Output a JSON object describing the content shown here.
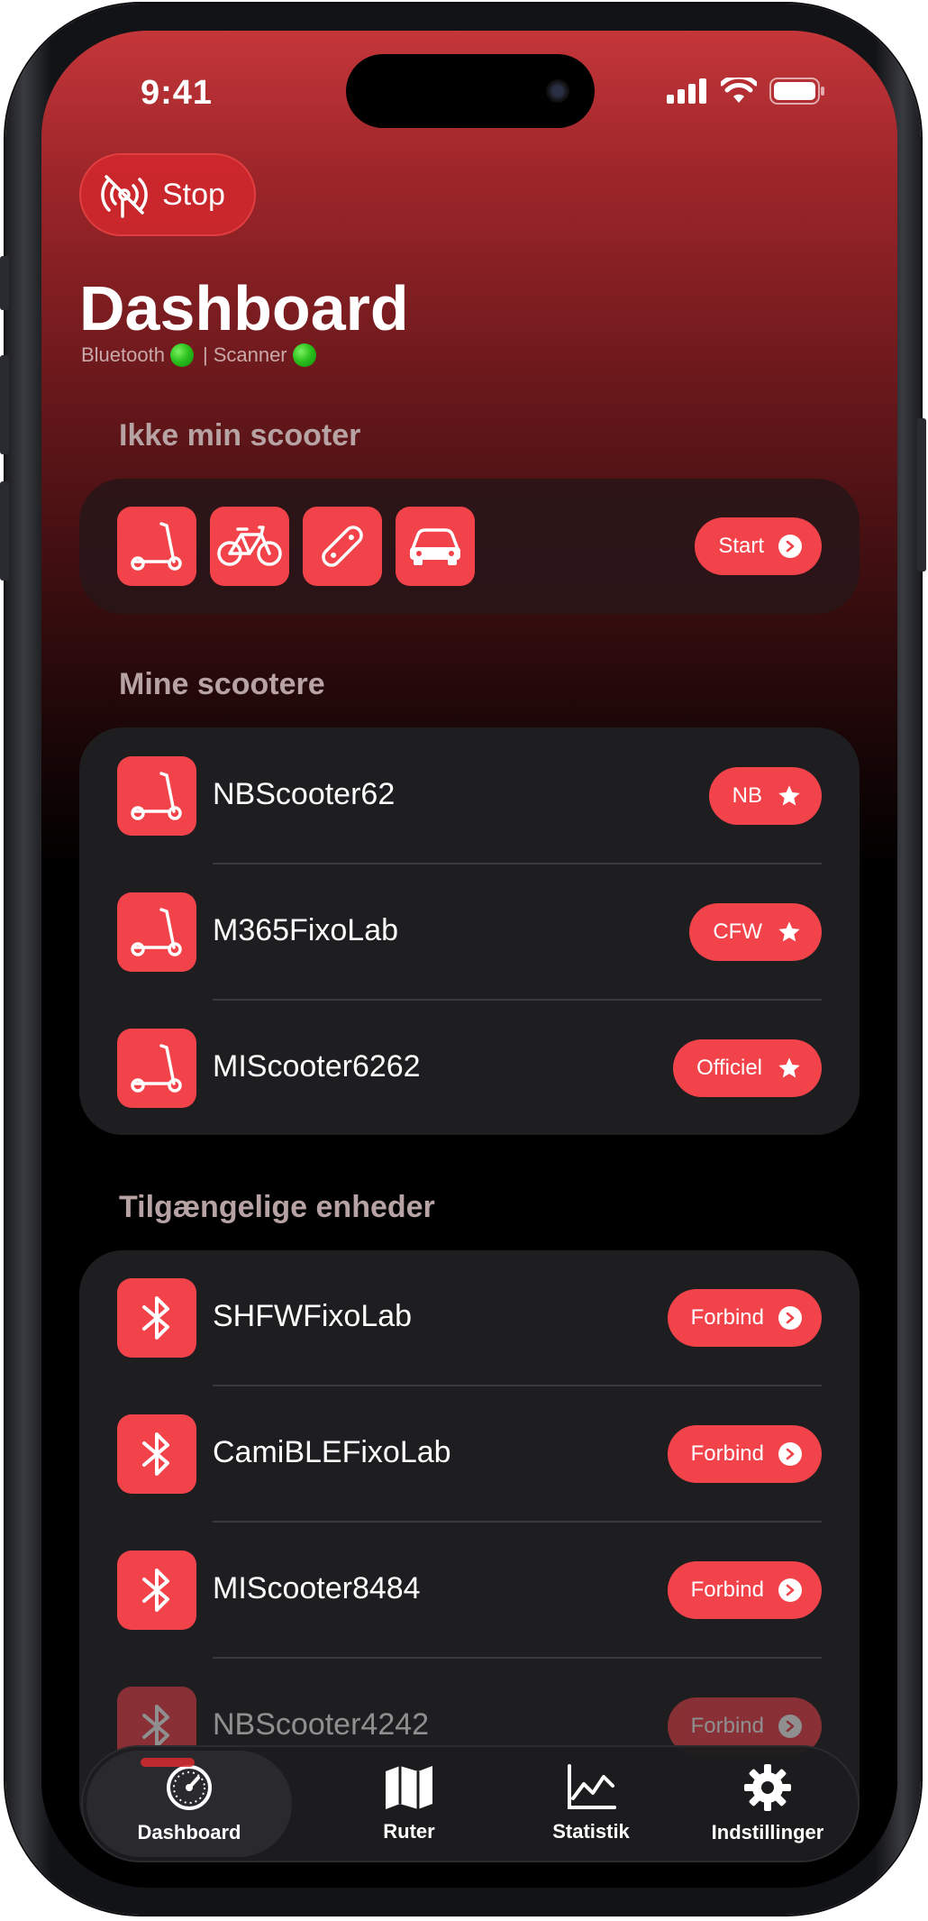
{
  "status_bar": {
    "time": "9:41"
  },
  "header": {
    "stop_label": "Stop",
    "title": "Dashboard",
    "bluetooth_label": "Bluetooth",
    "separator": "|",
    "scanner_label": "Scanner"
  },
  "not_my_scooter": {
    "title": "Ikke min scooter",
    "vehicle_icons": [
      "scooter-icon",
      "bicycle-icon",
      "skateboard-icon",
      "car-icon"
    ],
    "start_label": "Start"
  },
  "my_scooters": {
    "title": "Mine scootere",
    "items": [
      {
        "name": "NBScooter62",
        "badge": "NB"
      },
      {
        "name": "M365FixoLab",
        "badge": "CFW"
      },
      {
        "name": "MIScooter6262",
        "badge": "Officiel"
      }
    ]
  },
  "available_devices": {
    "title": "Tilgængelige enheder",
    "connect_label": "Forbind",
    "items": [
      {
        "name": "SHFWFixoLab"
      },
      {
        "name": "CamiBLEFixoLab"
      },
      {
        "name": "MIScooter8484"
      },
      {
        "name": "NBScooter4242"
      }
    ]
  },
  "tabbar": {
    "tabs": [
      {
        "label": "Dashboard",
        "icon": "speedometer-icon",
        "active": true
      },
      {
        "label": "Ruter",
        "icon": "map-icon",
        "active": false
      },
      {
        "label": "Statistik",
        "icon": "chart-icon",
        "active": false
      },
      {
        "label": "Indstillinger",
        "icon": "gear-icon",
        "active": false
      }
    ]
  },
  "colors": {
    "accent": "#f2434a",
    "card": "#1e1e20",
    "status_ok": "#2cc21e"
  }
}
